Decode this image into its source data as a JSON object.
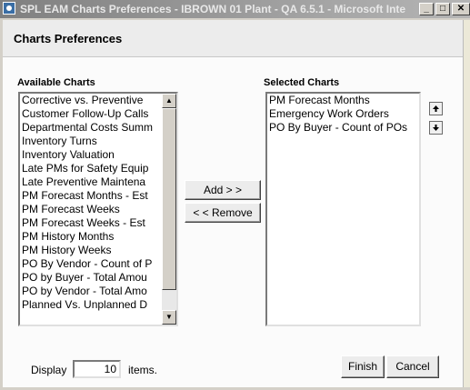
{
  "window": {
    "title": "SPL EAM Charts Preferences - IBROWN 01 Plant - QA 6.5.1 - Microsoft Inte"
  },
  "header": {
    "title": "Charts Preferences"
  },
  "available": {
    "label": "Available Charts",
    "items": [
      "Corrective vs. Preventive",
      "Customer Follow-Up Calls",
      "Departmental Costs Summ",
      "Inventory Turns",
      "Inventory Valuation",
      "Late PMs for Safety Equip",
      "Late Preventive Maintena",
      "PM Forecast Months - Est",
      "PM Forecast Weeks",
      "PM Forecast Weeks - Est",
      "PM History Months",
      "PM History Weeks",
      "PO By Vendor - Count of P",
      "PO by Buyer - Total Amou",
      "PO by Vendor - Total Amo",
      "Planned Vs. Unplanned D"
    ]
  },
  "selected": {
    "label": "Selected Charts",
    "items": [
      "PM Forecast Months",
      "Emergency Work Orders",
      "PO By Buyer - Count of POs"
    ]
  },
  "buttons": {
    "add": "Add > >",
    "remove": "< < Remove",
    "finish": "Finish",
    "cancel": "Cancel"
  },
  "display": {
    "prefix": "Display",
    "value": "10",
    "suffix": "items."
  },
  "icons": {
    "move_up": "arrow-up-icon",
    "move_down": "arrow-down-icon"
  }
}
